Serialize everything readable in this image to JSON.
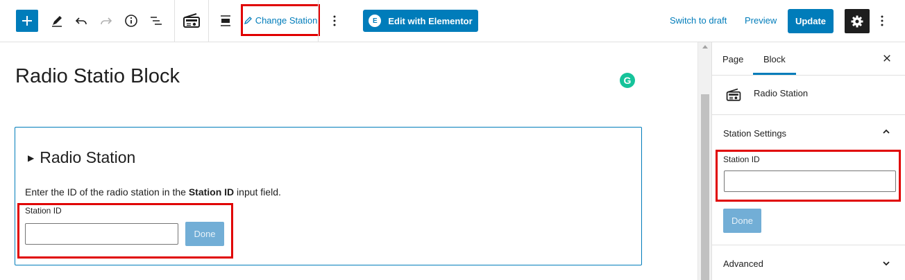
{
  "toolbar": {
    "change_station_label": "Change Station",
    "edit_elementor_label": "Edit with Elementor",
    "elementor_logo": "E",
    "switch_to_draft_label": "Switch to draft",
    "preview_label": "Preview",
    "update_label": "Update"
  },
  "editor": {
    "page_title": "Radio Statio Block",
    "grammarly_letter": "G",
    "block": {
      "heading": "Radio Station",
      "desc_before": "Enter the ID of the radio station in the ",
      "desc_bold": "Station ID",
      "desc_after": " input field.",
      "field_label": "Station ID",
      "field_value": "",
      "done_label": "Done"
    }
  },
  "sidebar": {
    "tabs": [
      {
        "label": "Page",
        "active": false
      },
      {
        "label": "Block",
        "active": true
      }
    ],
    "block_name": "Radio Station",
    "station_settings": {
      "title": "Station Settings",
      "expanded": true,
      "field_label": "Station ID",
      "field_value": "",
      "done_label": "Done"
    },
    "advanced": {
      "title": "Advanced",
      "expanded": false
    }
  },
  "colors": {
    "accent": "#007cba",
    "highlight_box": "#e00000",
    "grammarly": "#15c39a"
  }
}
